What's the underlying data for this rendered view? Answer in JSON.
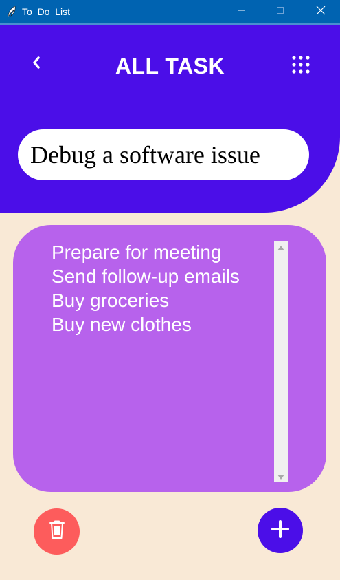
{
  "window": {
    "title": "To_Do_List",
    "controls": {
      "minimize_icon": "minimize-icon",
      "maximize_icon": "maximize-icon",
      "close_icon": "close-icon"
    }
  },
  "header": {
    "title": "ALL TASK",
    "back_icon": "chevron-left-icon",
    "menu_icon": "grid-dots-icon"
  },
  "task_input": {
    "value": "Debug a software issue"
  },
  "task_list": {
    "items": [
      "Prepare for meeting",
      "Send follow-up emails",
      "Buy groceries",
      "Buy new clothes"
    ]
  },
  "actions": {
    "delete_icon": "trash-icon",
    "add_icon": "plus-icon"
  },
  "colors": {
    "titlebar": "#0063b1",
    "header": "#4b0ee8",
    "background": "#f9e9d6",
    "panel": "#b762ec",
    "delete_button": "#fd5c5c",
    "add_button": "#4b0ee8"
  }
}
